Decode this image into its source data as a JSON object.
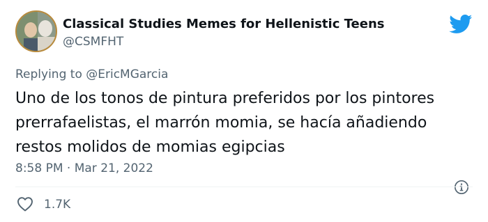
{
  "header": {
    "display_name": "Classical Studies Memes for Hellenistic Teens",
    "handle": "@CSMFHT"
  },
  "reply": {
    "prefix": "Replying to ",
    "mention": "@EricMGarcia"
  },
  "tweet": {
    "text": "Uno de los tonos de pintura preferidos por los pintores prerrafaelistas, el marrón momia, se hacía añadiendo restos molidos de momias egipcias"
  },
  "meta": {
    "time": "8:58 PM",
    "separator": " · ",
    "date": "Mar 21, 2022"
  },
  "actions": {
    "like_count": "1.7K"
  },
  "colors": {
    "twitter_blue": "#1d9bf0",
    "secondary_text": "#536471",
    "primary_text": "#0f1419"
  },
  "icons": {
    "brand": "twitter-bird-icon",
    "info": "info-icon",
    "like": "heart-icon"
  }
}
